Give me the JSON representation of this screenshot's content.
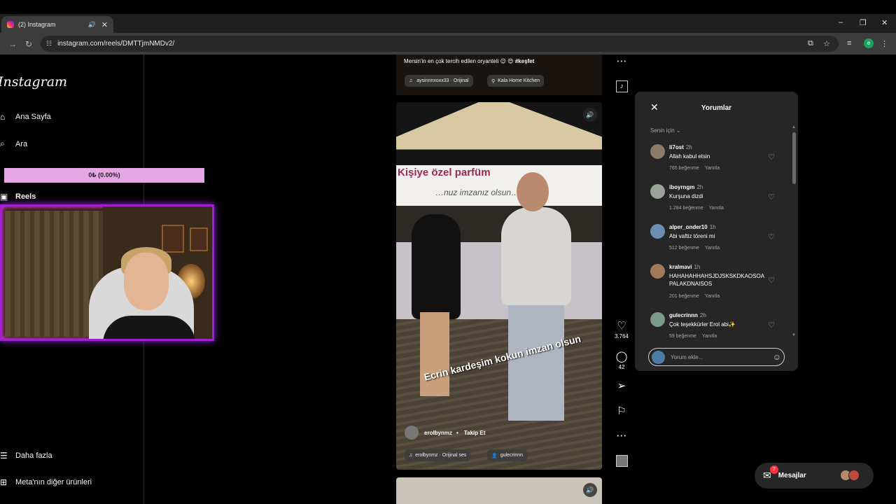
{
  "browser": {
    "tab_title": "(2) Instagram",
    "new_tab": "+",
    "url": "instagram.com/reels/DMTTjmNMDv2/",
    "profile_letter": "e",
    "window_controls": [
      "–",
      "❐",
      "✕"
    ]
  },
  "sidebar": {
    "logo": "Instagram",
    "items": [
      {
        "label": "Ana Sayfa",
        "icon": "home-icon",
        "glyph": "⌂"
      },
      {
        "label": "Ara",
        "icon": "search-icon",
        "glyph": "⌕"
      },
      {
        "label": "Reels",
        "icon": "reels-icon",
        "glyph": "▣"
      },
      {
        "label": "Daha fazla",
        "icon": "menu-icon",
        "glyph": "☰"
      },
      {
        "label": "Meta'nın diğer ürünleri",
        "icon": "grid-icon",
        "glyph": "⊞"
      }
    ]
  },
  "overlay": {
    "bar_text": "0₺ (0.00%)"
  },
  "reel_prev": {
    "caption_text": "Mersin'in en çok tercih edilen oryanteli 😉 😍 ",
    "caption_tag": "#keşfet",
    "audio": "aysinnnxoxx33 · Orijinal",
    "location": "Kala Home Kitchen"
  },
  "reel": {
    "banner_line1": "Kişiye özel parfüm",
    "banner_line2": "…nuz imzanız olsun…",
    "overlay_text": "Ecrin kardeşim kokun imzan olsun",
    "author": "erolbynmz",
    "follow": "Takip Et",
    "audio": "erolbynmz · Orijinal ses",
    "tagged": "gulecrinnn"
  },
  "actions": {
    "likes": "3.764",
    "comments": "42"
  },
  "comments_panel": {
    "title": "Yorumlar",
    "filter": "Senin için",
    "input_placeholder": "Yorum ekle...",
    "reply_label": "Yanıtla",
    "items": [
      {
        "user": "li7ost",
        "time": "2h",
        "text": "Allah kabul etsin",
        "likes": "765 beğenme",
        "avatar_color": "#8c7b6a"
      },
      {
        "user": "iboyrngm",
        "time": "2h",
        "text": "Kurşuna dizdi",
        "likes": "1.284 beğenme",
        "avatar_color": "#9aa29a"
      },
      {
        "user": "alper_onder10",
        "time": "1h",
        "text": "Abi vaftiz töreni mi",
        "likes": "512 beğenme",
        "avatar_color": "#6b8fb0"
      },
      {
        "user": "kralmavi",
        "time": "1h",
        "text": "HAHAHAHHAHSJDJSKSKDKAOSOAPALAKDNAISOS",
        "likes": "201 beğenme",
        "avatar_color": "#a07a5a"
      },
      {
        "user": "gulecrinnn",
        "time": "2h",
        "text": "Çok teşekkürler Erol abi✨",
        "likes": "59 beğenme",
        "avatar_color": "#7a9a8a"
      }
    ]
  },
  "messages": {
    "label": "Mesajlar",
    "badge": "2"
  },
  "colors": {
    "accent": "#a020d0",
    "overlay_bar": "#e4a6e4",
    "notification": "#ff3040",
    "panel": "#262626"
  }
}
